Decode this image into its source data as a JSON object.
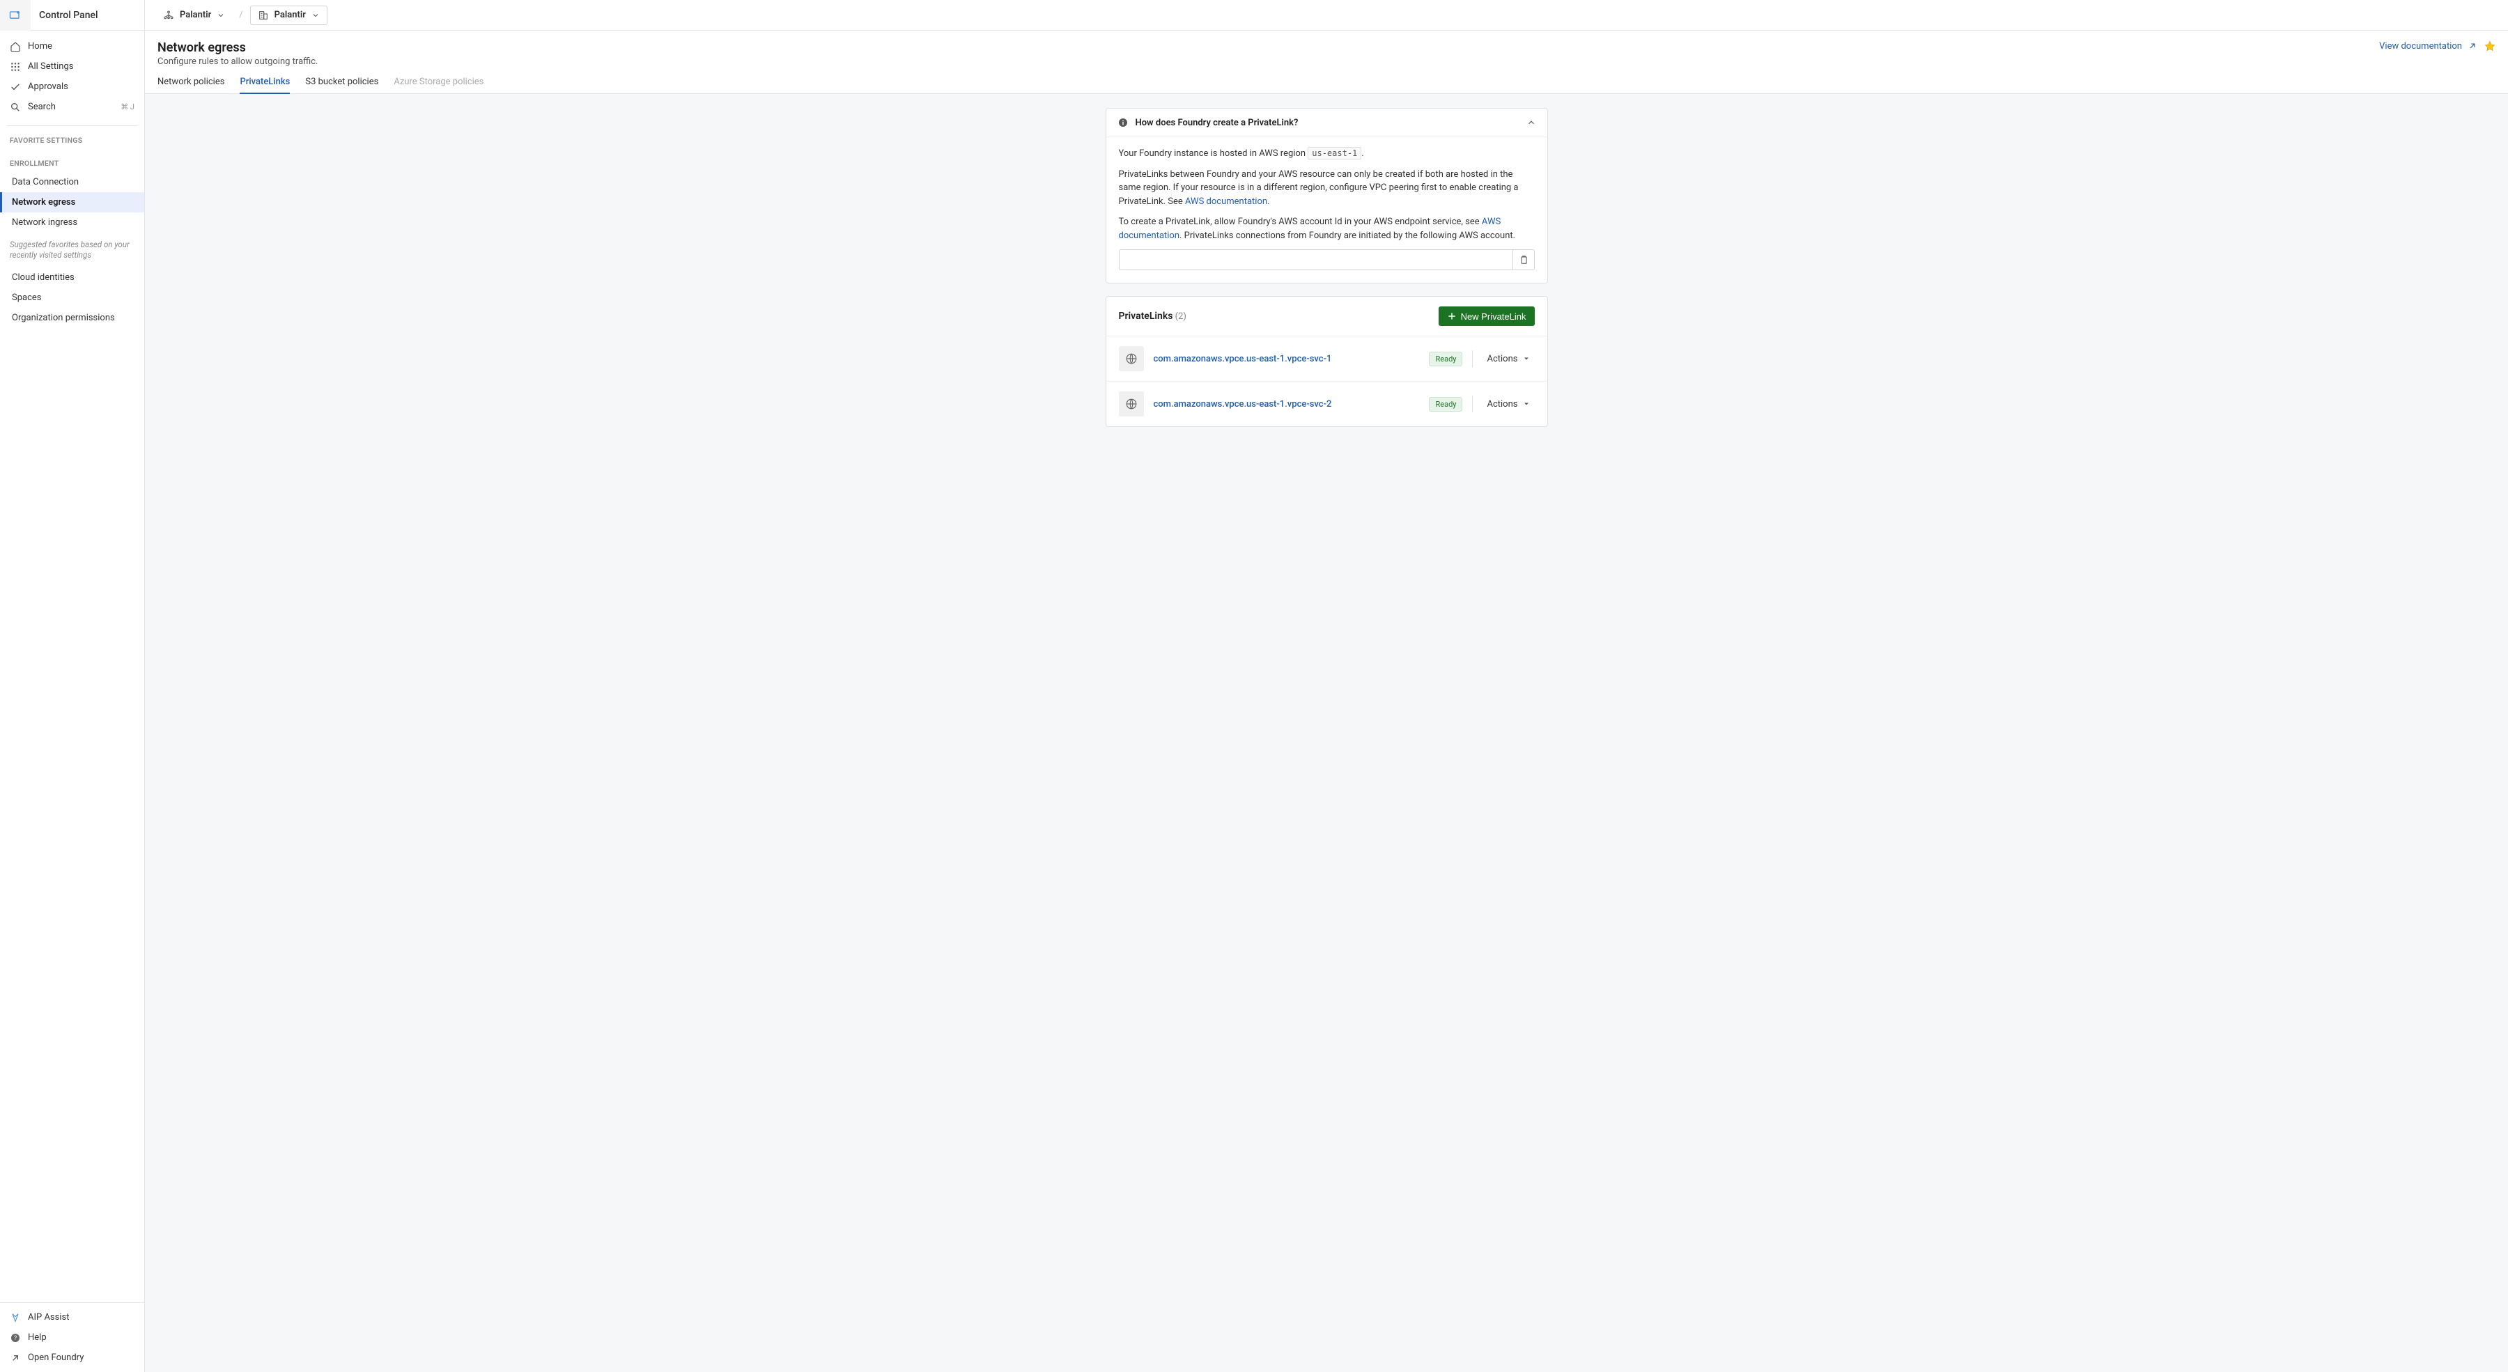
{
  "app_title": "Control Panel",
  "breadcrumbs": {
    "org": "Palantir",
    "project": "Palantir"
  },
  "sidebar": {
    "items": [
      {
        "label": "Home"
      },
      {
        "label": "All Settings"
      },
      {
        "label": "Approvals"
      },
      {
        "label": "Search",
        "shortcut": "⌘ J"
      }
    ],
    "favorites_label": "FAVORITE SETTINGS",
    "enrollment_label": "ENROLLMENT",
    "enrollment": [
      {
        "label": "Data Connection"
      },
      {
        "label": "Network egress"
      },
      {
        "label": "Network ingress"
      }
    ],
    "suggested_text": "Suggested favorites based on your recently visited settings",
    "suggested": [
      {
        "label": "Cloud identities"
      },
      {
        "label": "Spaces"
      },
      {
        "label": "Organization permissions"
      }
    ],
    "bottom": [
      {
        "label": "AIP Assist"
      },
      {
        "label": "Help"
      },
      {
        "label": "Open Foundry"
      }
    ]
  },
  "page": {
    "title": "Network egress",
    "subtitle": "Configure rules to allow outgoing traffic.",
    "doc_link": "View documentation"
  },
  "tabs": [
    {
      "label": "Network policies"
    },
    {
      "label": "PrivateLinks"
    },
    {
      "label": "S3 bucket policies"
    },
    {
      "label": "Azure Storage policies"
    }
  ],
  "info_card": {
    "title": "How does Foundry create a PrivateLink?",
    "p1_prefix": "Your Foundry instance is hosted in AWS region ",
    "region": "us-east-1",
    "p1_suffix": ".",
    "p2_a": "PrivateLinks between Foundry and your AWS resource can only be created if both are hosted in the same region. If your resource is in a different region, configure VPC peering first to enable creating a PrivateLink. See ",
    "p2_link": "AWS documentation",
    "p2_b": ".",
    "p3_a": "To create a PrivateLink, allow Foundry's AWS account Id in your AWS endpoint service, see ",
    "p3_link": "AWS documentation",
    "p3_b": ". PrivateLinks connections from Foundry are initiated by the following AWS account."
  },
  "list": {
    "title": "PrivateLinks",
    "count": "(2)",
    "new_button": "New PrivateLink",
    "actions_label": "Actions",
    "rows": [
      {
        "name": "com.amazonaws.vpce.us-east-1.vpce-svc-1",
        "status": "Ready"
      },
      {
        "name": "com.amazonaws.vpce.us-east-1.vpce-svc-2",
        "status": "Ready"
      }
    ]
  }
}
